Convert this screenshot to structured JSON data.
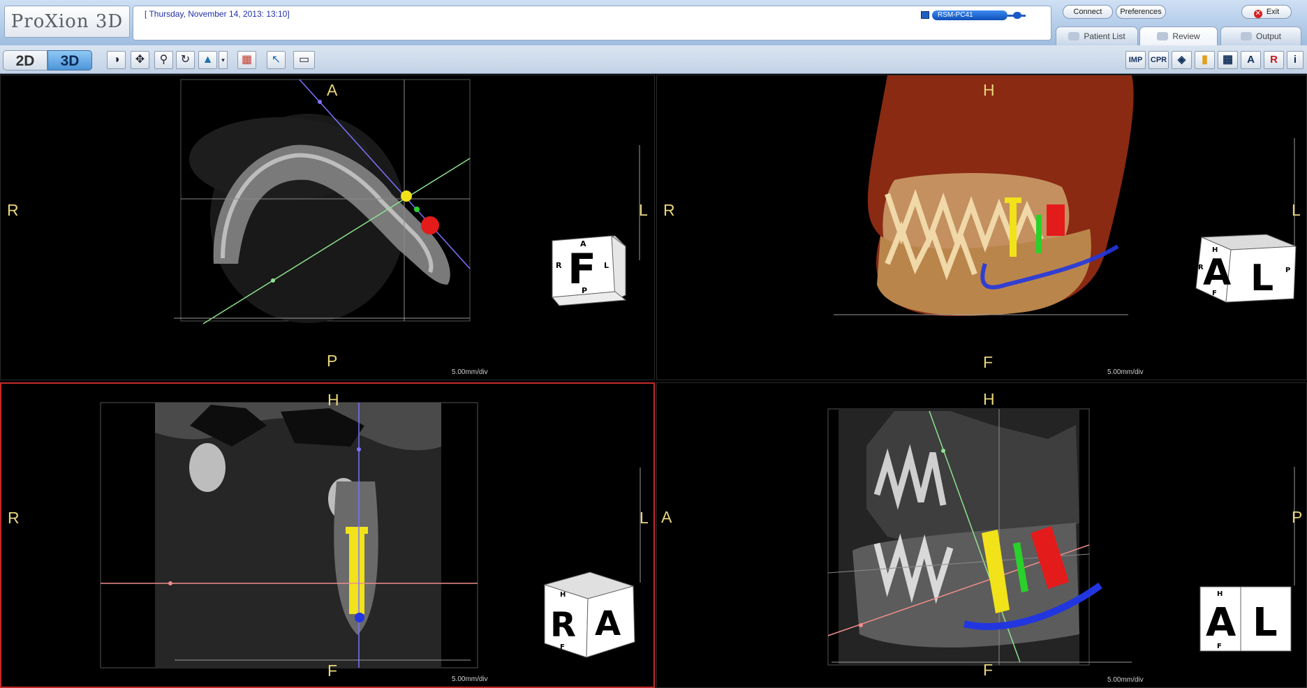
{
  "header": {
    "logo": "ProXion 3D",
    "datetime": "[ Thursday, November 14, 2013: 13:10]",
    "pc_name": "RSM-PC41",
    "connect_label": "Connect",
    "preferences_label": "Preferences",
    "exit_label": "Exit",
    "tabs": [
      {
        "label": "Patient List",
        "icon": "person-icon"
      },
      {
        "label": "Review",
        "icon": "eye-icon"
      },
      {
        "label": "Output",
        "icon": "printer-icon"
      }
    ]
  },
  "toolbar": {
    "mode_2d": "2D",
    "mode_3d": "3D",
    "active_mode": "3D",
    "tools_left": [
      {
        "name": "contrast-icon",
        "glyph": "◑"
      },
      {
        "name": "pan-icon",
        "glyph": "✥"
      },
      {
        "name": "zoom-icon",
        "glyph": "⚲"
      },
      {
        "name": "rotate-icon",
        "glyph": "↻"
      },
      {
        "name": "render-mode-icon",
        "glyph": "▲"
      },
      {
        "name": "dropdown-arrow-icon",
        "glyph": "▾"
      },
      {
        "name": "layout-grid-icon",
        "glyph": "▦"
      },
      {
        "name": "pointer-icon",
        "glyph": "↖"
      },
      {
        "name": "ruler-icon",
        "glyph": "▭"
      }
    ],
    "tools_right": [
      {
        "name": "imp-button",
        "label": "IMP"
      },
      {
        "name": "cpr-button",
        "label": "CPR"
      },
      {
        "name": "layers-icon",
        "label": "◈"
      },
      {
        "name": "color-bar-icon",
        "label": "▮"
      },
      {
        "name": "quad-view-icon",
        "label": "▦"
      },
      {
        "name": "annotation-icon",
        "label": "A"
      },
      {
        "name": "register-icon",
        "label": "R"
      },
      {
        "name": "info-icon",
        "label": "i"
      }
    ]
  },
  "viewports": {
    "axial": {
      "top": "A",
      "bottom": "P",
      "left": "R",
      "right": "L",
      "scale": "5.00mm/div",
      "cube_face": "F",
      "cube_top": "A",
      "cube_bottom": "P",
      "cube_left": "R",
      "cube_right": "L"
    },
    "volume": {
      "top": "H",
      "bottom": "F",
      "left": "R",
      "right": "L",
      "scale": "5.00mm/div",
      "cube_face1": "A",
      "cube_face2": "L",
      "cube_top": "H",
      "cube_bottom": "F",
      "cube_left": "R",
      "cube_right": "P"
    },
    "coronal": {
      "top": "H",
      "bottom": "F",
      "left": "R",
      "right": "L",
      "scale": "5.00mm/div",
      "cube_face1": "R",
      "cube_face2": "A",
      "cube_top": "H",
      "cube_bottom": "F"
    },
    "sagittal": {
      "top": "H",
      "bottom": "F",
      "left": "A",
      "right": "P",
      "scale": "5.00mm/div",
      "cube_face1": "A",
      "cube_face2": "L",
      "cube_top": "H",
      "cube_bottom": "F"
    }
  },
  "colors": {
    "implant_yellow": "#f2e21a",
    "implant_green": "#2ad12a",
    "implant_red": "#e41b1b",
    "nerve_blue": "#2236e0",
    "guide_purple": "#7d73ff",
    "guide_green": "#8fe28f",
    "guide_pink": "#f08c8c",
    "orientation_label": "#e8d67a",
    "active_viewport_border": "#c42a2a"
  }
}
